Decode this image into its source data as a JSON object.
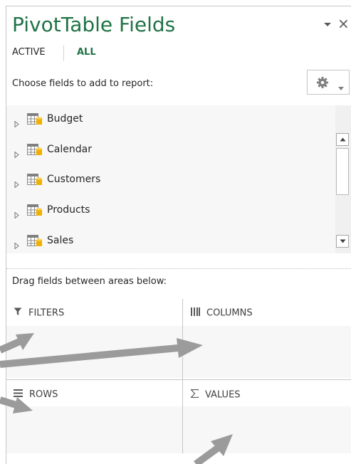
{
  "pane": {
    "title": "PivotTable Fields",
    "close_glyph": "×"
  },
  "tabs": [
    {
      "label": "ACTIVE",
      "selected": false
    },
    {
      "label": "ALL",
      "selected": true
    }
  ],
  "choose_label": "Choose fields to add to report:",
  "tools_button": {
    "icon": "gear-icon"
  },
  "fields": [
    {
      "name": "Budget",
      "icon": "table-icon"
    },
    {
      "name": "Calendar",
      "icon": "table-icon"
    },
    {
      "name": "Customers",
      "icon": "table-icon"
    },
    {
      "name": "Products",
      "icon": "table-icon"
    },
    {
      "name": "Sales",
      "icon": "table-icon"
    }
  ],
  "drag_label": "Drag fields between areas below:",
  "areas": {
    "filters": {
      "label": "FILTERS",
      "icon": "filter-icon"
    },
    "columns": {
      "label": "COLUMNS",
      "icon": "columns-icon"
    },
    "rows": {
      "label": "ROWS",
      "icon": "rows-icon"
    },
    "values": {
      "label": "VALUES",
      "icon": "sigma-icon"
    }
  },
  "colors": {
    "accent": "#217346",
    "list_bg": "#f7f7f7",
    "annotation_arrow": "#9b9b9b"
  }
}
